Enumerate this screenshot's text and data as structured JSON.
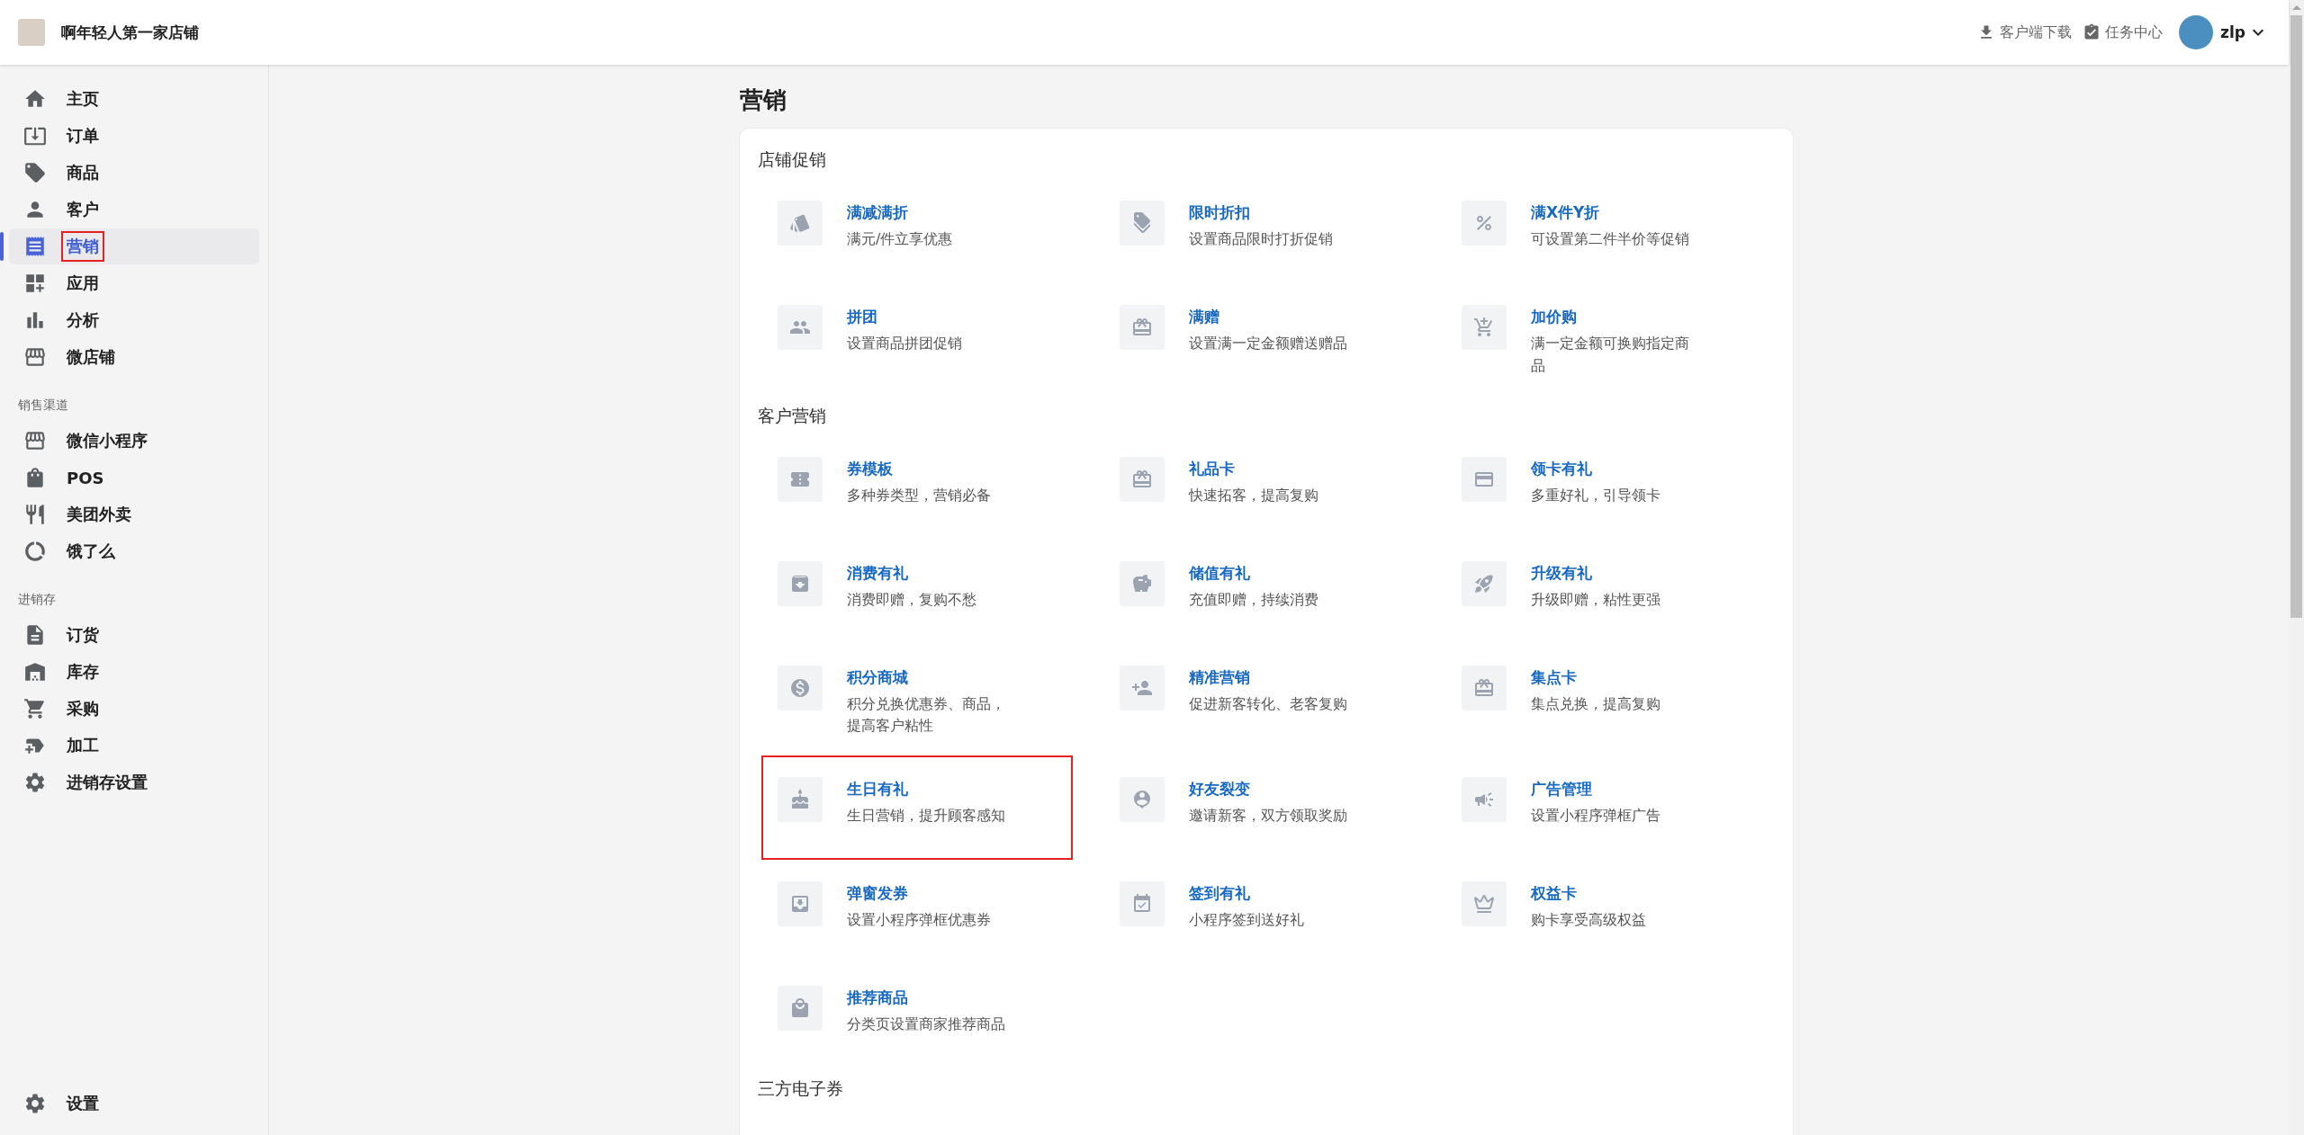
{
  "header": {
    "store_name": "啊年轻人第一家店铺",
    "actions": [
      {
        "label": "客户端下载"
      },
      {
        "label": "任务中心"
      }
    ],
    "user": {
      "name": "zlp"
    }
  },
  "sidebar": {
    "groups": [
      {
        "items": [
          {
            "label": "主页",
            "selected": false,
            "highlighted": false
          },
          {
            "label": "订单",
            "selected": false,
            "highlighted": false
          },
          {
            "label": "商品",
            "selected": false,
            "highlighted": false
          },
          {
            "label": "客户",
            "selected": false,
            "highlighted": false
          },
          {
            "label": "营销",
            "selected": true,
            "highlighted": true
          },
          {
            "label": "应用",
            "selected": false,
            "highlighted": false
          },
          {
            "label": "分析",
            "selected": false,
            "highlighted": false
          },
          {
            "label": "微店铺",
            "selected": false,
            "highlighted": false
          }
        ]
      },
      {
        "heading": "销售渠道",
        "items": [
          {
            "label": "微信小程序",
            "selected": false,
            "highlighted": false
          },
          {
            "label": "POS",
            "selected": false,
            "highlighted": false
          },
          {
            "label": "美团外卖",
            "selected": false,
            "highlighted": false
          },
          {
            "label": "饿了么",
            "selected": false,
            "highlighted": false
          }
        ]
      },
      {
        "heading": "进销存",
        "items": [
          {
            "label": "订货",
            "selected": false,
            "highlighted": false
          },
          {
            "label": "库存",
            "selected": false,
            "highlighted": false
          },
          {
            "label": "采购",
            "selected": false,
            "highlighted": false
          },
          {
            "label": "加工",
            "selected": false,
            "highlighted": false
          },
          {
            "label": "进销存设置",
            "selected": false,
            "highlighted": false
          }
        ]
      }
    ],
    "bottom_item": {
      "label": "设置",
      "selected": false
    }
  },
  "page": {
    "title": "营销",
    "sections": [
      {
        "title": "店铺促销",
        "tools": [
          {
            "name": "满减满折",
            "description": "满元/件立享优惠",
            "highlighted": false
          },
          {
            "name": "限时折扣",
            "description": "设置商品限时打折促销",
            "highlighted": false
          },
          {
            "name": "满X件Y折",
            "description": "可设置第二件半价等促销",
            "highlighted": false
          },
          {
            "name": "拼团",
            "description": "设置商品拼团促销",
            "highlighted": false
          },
          {
            "name": "满赠",
            "description": "设置满一定金额赠送赠品",
            "highlighted": false
          },
          {
            "name": "加价购",
            "description": "满一定金额可换购指定商品",
            "highlighted": false
          }
        ]
      },
      {
        "title": "客户营销",
        "tools": [
          {
            "name": "券模板",
            "description": "多种券类型，营销必备",
            "highlighted": false
          },
          {
            "name": "礼品卡",
            "description": "快速拓客，提高复购",
            "highlighted": false
          },
          {
            "name": "领卡有礼",
            "description": "多重好礼，引导领卡",
            "highlighted": false
          },
          {
            "name": "消费有礼",
            "description": "消费即赠，复购不愁",
            "highlighted": false
          },
          {
            "name": "储值有礼",
            "description": "充值即赠，持续消费",
            "highlighted": false
          },
          {
            "name": "升级有礼",
            "description": "升级即赠，粘性更强",
            "highlighted": false
          },
          {
            "name": "积分商城",
            "description": "积分兑换优惠券、商品，提高客户粘性",
            "highlighted": false
          },
          {
            "name": "精准营销",
            "description": "促进新客转化、老客复购",
            "highlighted": false
          },
          {
            "name": "集点卡",
            "description": "集点兑换，提高复购",
            "highlighted": false
          },
          {
            "name": "生日有礼",
            "description": "生日营销，提升顾客感知",
            "highlighted": true
          },
          {
            "name": "好友裂变",
            "description": "邀请新客，双方领取奖励",
            "highlighted": false
          },
          {
            "name": "广告管理",
            "description": "设置小程序弹框广告",
            "highlighted": false
          },
          {
            "name": "弹窗发券",
            "description": "设置小程序弹框优惠券",
            "highlighted": false
          },
          {
            "name": "签到有礼",
            "description": "小程序签到送好礼",
            "highlighted": false
          },
          {
            "name": "权益卡",
            "description": "购卡享受高级权益",
            "highlighted": false
          },
          {
            "name": "推荐商品",
            "description": "分类页设置商家推荐商品",
            "highlighted": false
          }
        ]
      },
      {
        "title": "三方电子券"
      }
    ]
  }
}
